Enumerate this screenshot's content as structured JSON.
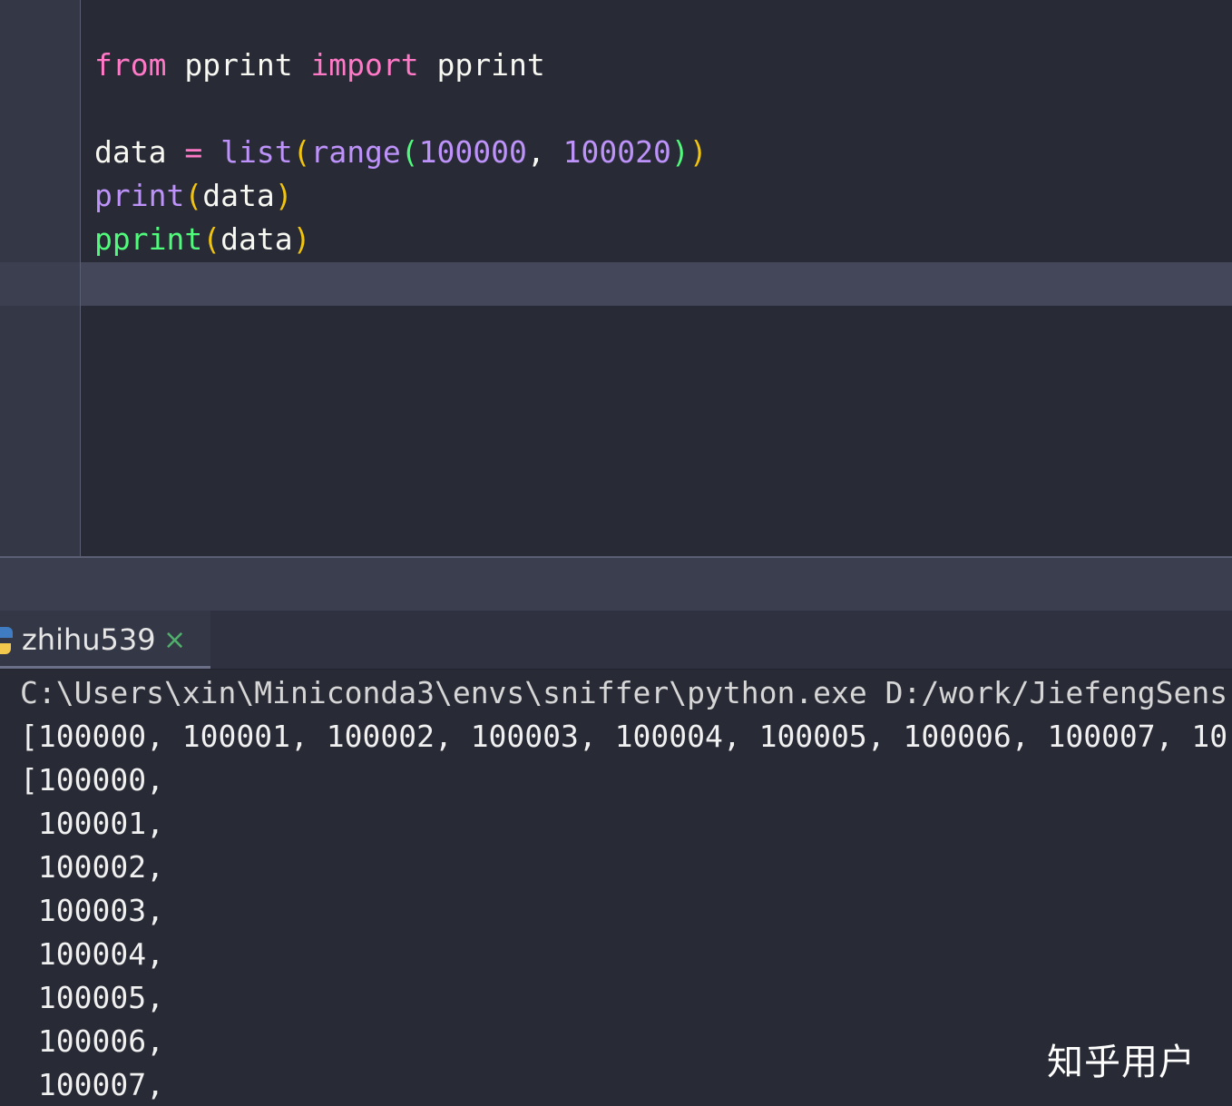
{
  "editor": {
    "lines": {
      "l1": {
        "kw_from": "from",
        "mod": " pprint ",
        "kw_import": "import",
        "name": " pprint"
      },
      "l3": {
        "var": "data ",
        "op": "=",
        "sp": " ",
        "list": "list",
        "paren1": "(",
        "range": "range",
        "paren2": "(",
        "n1": "100000",
        "comma": ", ",
        "n2": "100020",
        "close2": ")",
        "close1": ")"
      },
      "l4": {
        "fn": "print",
        "open": "(",
        "arg": "data",
        "close": ")"
      },
      "l5": {
        "fn": "pprint",
        "open": "(",
        "arg": "data",
        "close": ")"
      }
    }
  },
  "run_tab": {
    "label": "zhihu539",
    "close": "×",
    "icon": "python-icon"
  },
  "console": {
    "lines": [
      "C:\\Users\\xin\\Miniconda3\\envs\\sniffer\\python.exe D:/work/JiefengSens",
      "[100000, 100001, 100002, 100003, 100004, 100005, 100006, 100007, 10",
      "[100000,",
      " 100001,",
      " 100002,",
      " 100003,",
      " 100004,",
      " 100005,",
      " 100006,",
      " 100007,"
    ]
  },
  "watermark": "知乎用户",
  "colors": {
    "background": "#282a36",
    "keyword": "#ff79c6",
    "builtin": "#bd93f9",
    "pprint_fn": "#50fa7b",
    "bracket_outer": "#f1c40f",
    "bracket_inner": "#50fa7b"
  }
}
